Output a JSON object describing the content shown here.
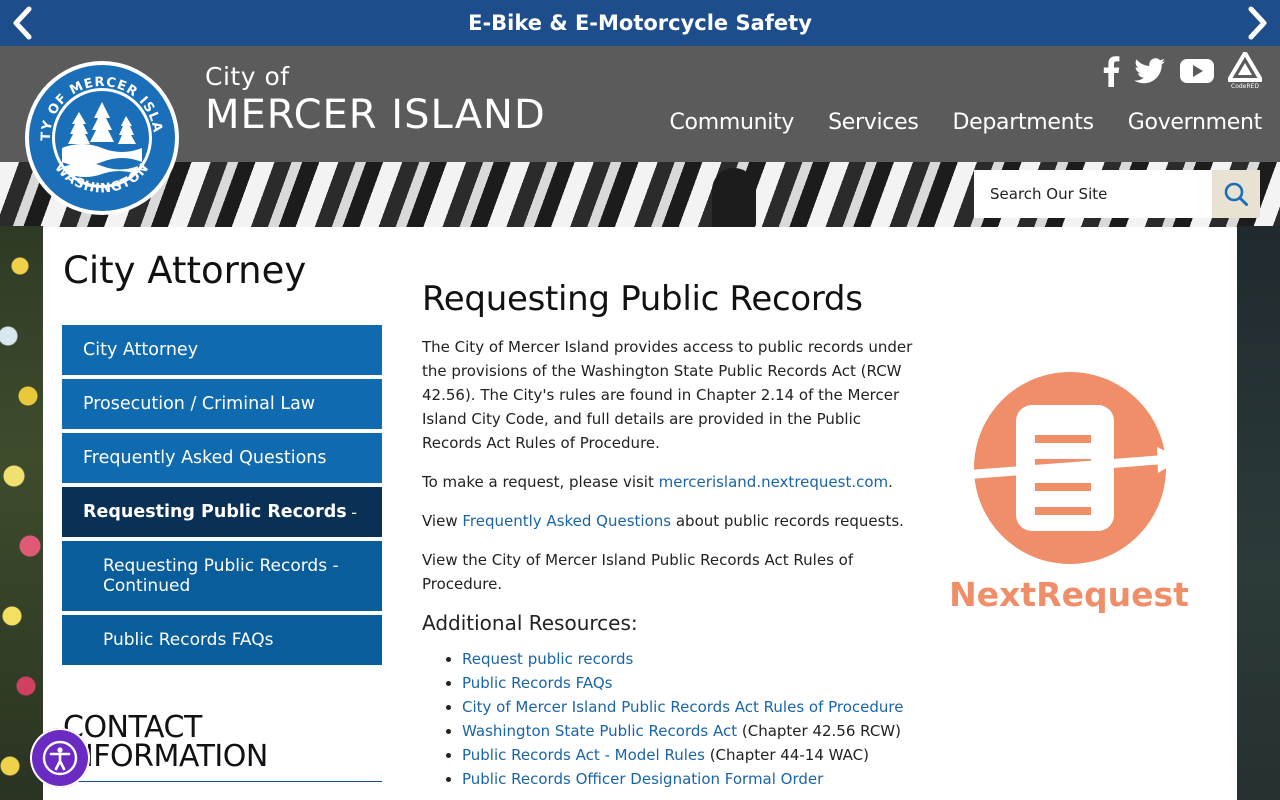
{
  "alert": {
    "text": "E-Bike & E-Motorcycle Safety",
    "prev_icon": "chevron-left-icon",
    "next_icon": "chevron-right-icon"
  },
  "brand": {
    "city_of": "City of",
    "name": "MERCER ISLAND",
    "seal_text_top": "CITY OF MERCER ISLAND",
    "seal_text_bottom": "WASHINGTON"
  },
  "social": {
    "facebook": "facebook-icon",
    "twitter": "twitter-icon",
    "youtube": "youtube-icon",
    "codered_label": "CodeRED"
  },
  "nav": [
    "Community",
    "Services",
    "Departments",
    "Government"
  ],
  "search": {
    "placeholder": "Search Our Site"
  },
  "sidebar": {
    "title": "City Attorney",
    "items": [
      {
        "label": "City Attorney"
      },
      {
        "label": "Prosecution / Criminal Law"
      },
      {
        "label": "Frequently Asked Questions"
      },
      {
        "label": "Requesting Public Records",
        "toggle": "-"
      },
      {
        "label": "Requesting Public Records - Continued"
      },
      {
        "label": "Public Records FAQs"
      }
    ],
    "contact_title": "CONTACT INFORMATION"
  },
  "article": {
    "title": "Requesting Public Records",
    "p1": "The City of Mercer Island provides access to public records under the provisions of the Washington State Public Records Act (RCW 42.56). The City's rules are found in Chapter 2.14 of the Mercer Island City Code, and full details are provided in the Public Records Act Rules of Procedure.",
    "p2_prefix": "To make a request, please visit ",
    "p2_link": "mercerisland.nextrequest.com",
    "p2_suffix": ".",
    "p3_prefix": "View ",
    "p3_link": "Frequently Asked Questions",
    "p3_suffix": " about public records requests.",
    "p4": "View the City of Mercer Island Public Records Act Rules of Procedure.",
    "resources_title": "Additional Resources:",
    "resources": [
      {
        "link": "Request public records",
        "suffix": ""
      },
      {
        "link": "Public Records FAQs",
        "suffix": ""
      },
      {
        "link": "City of Mercer Island Public Records Act Rules of Procedure",
        "suffix": ""
      },
      {
        "link": "Washington State Public Records Act",
        "suffix": " (Chapter 42.56 RCW)"
      },
      {
        "link": "Public Records Act - Model Rules",
        "suffix": " (Chapter 44-14 WAC)"
      },
      {
        "link": "Public Records Officer Designation Formal Order",
        "suffix": ""
      }
    ]
  },
  "nextrequest": {
    "label": "NextRequest",
    "color": "#ef8e69"
  },
  "accessibility": {
    "icon": "accessibility-icon",
    "color": "#6b2bc2"
  }
}
